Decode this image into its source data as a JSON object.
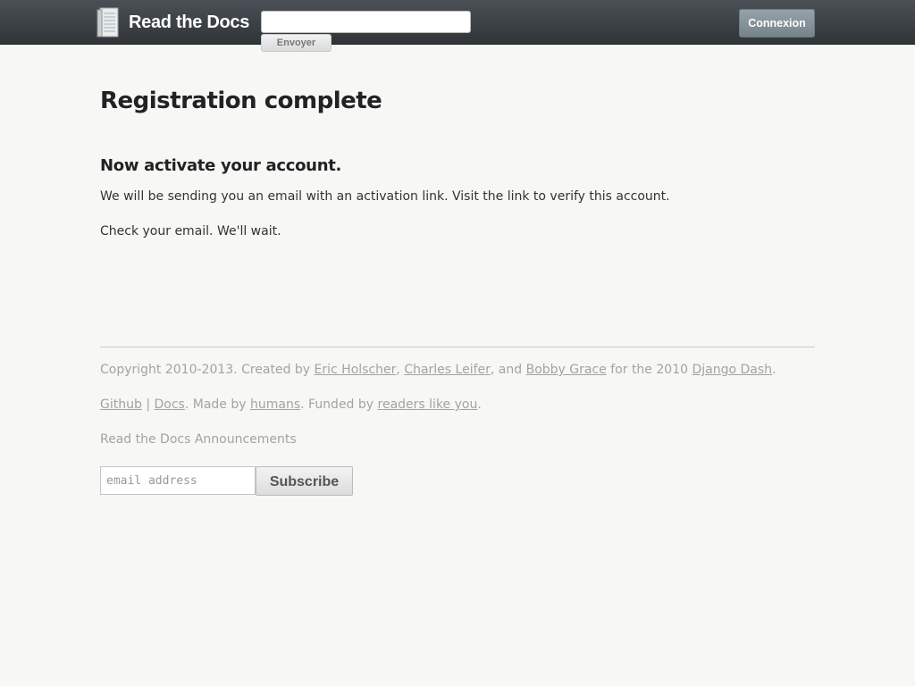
{
  "header": {
    "brand": "Read the Docs",
    "search_placeholder": "",
    "search_button": "Envoyer",
    "login_button": "Connexion"
  },
  "main": {
    "title": "Registration complete",
    "subtitle": "Now activate your account.",
    "paragraph_1": "We will be sending you an email with an activation link. Visit the link to verify this account.",
    "paragraph_2": "Check your email. We'll wait."
  },
  "footer": {
    "copyright_prefix": "Copyright 2010-2013. Created by ",
    "author_1": "Eric Holscher",
    "sep_1": ", ",
    "author_2": "Charles Leifer",
    "sep_2": ", and ",
    "author_3": "Bobby Grace",
    "copyright_mid": " for the 2010 ",
    "django_dash": "Django Dash",
    "copyright_end": ".",
    "github": "Github",
    "pipe": " | ",
    "docs": "Docs",
    "made_by": ". Made by ",
    "humans": "humans",
    "funded_by": ". Funded by ",
    "readers": "readers like you",
    "end": ".",
    "announcements": "Read the Docs Announcements",
    "email_placeholder": "email address",
    "subscribe_button": "Subscribe"
  }
}
